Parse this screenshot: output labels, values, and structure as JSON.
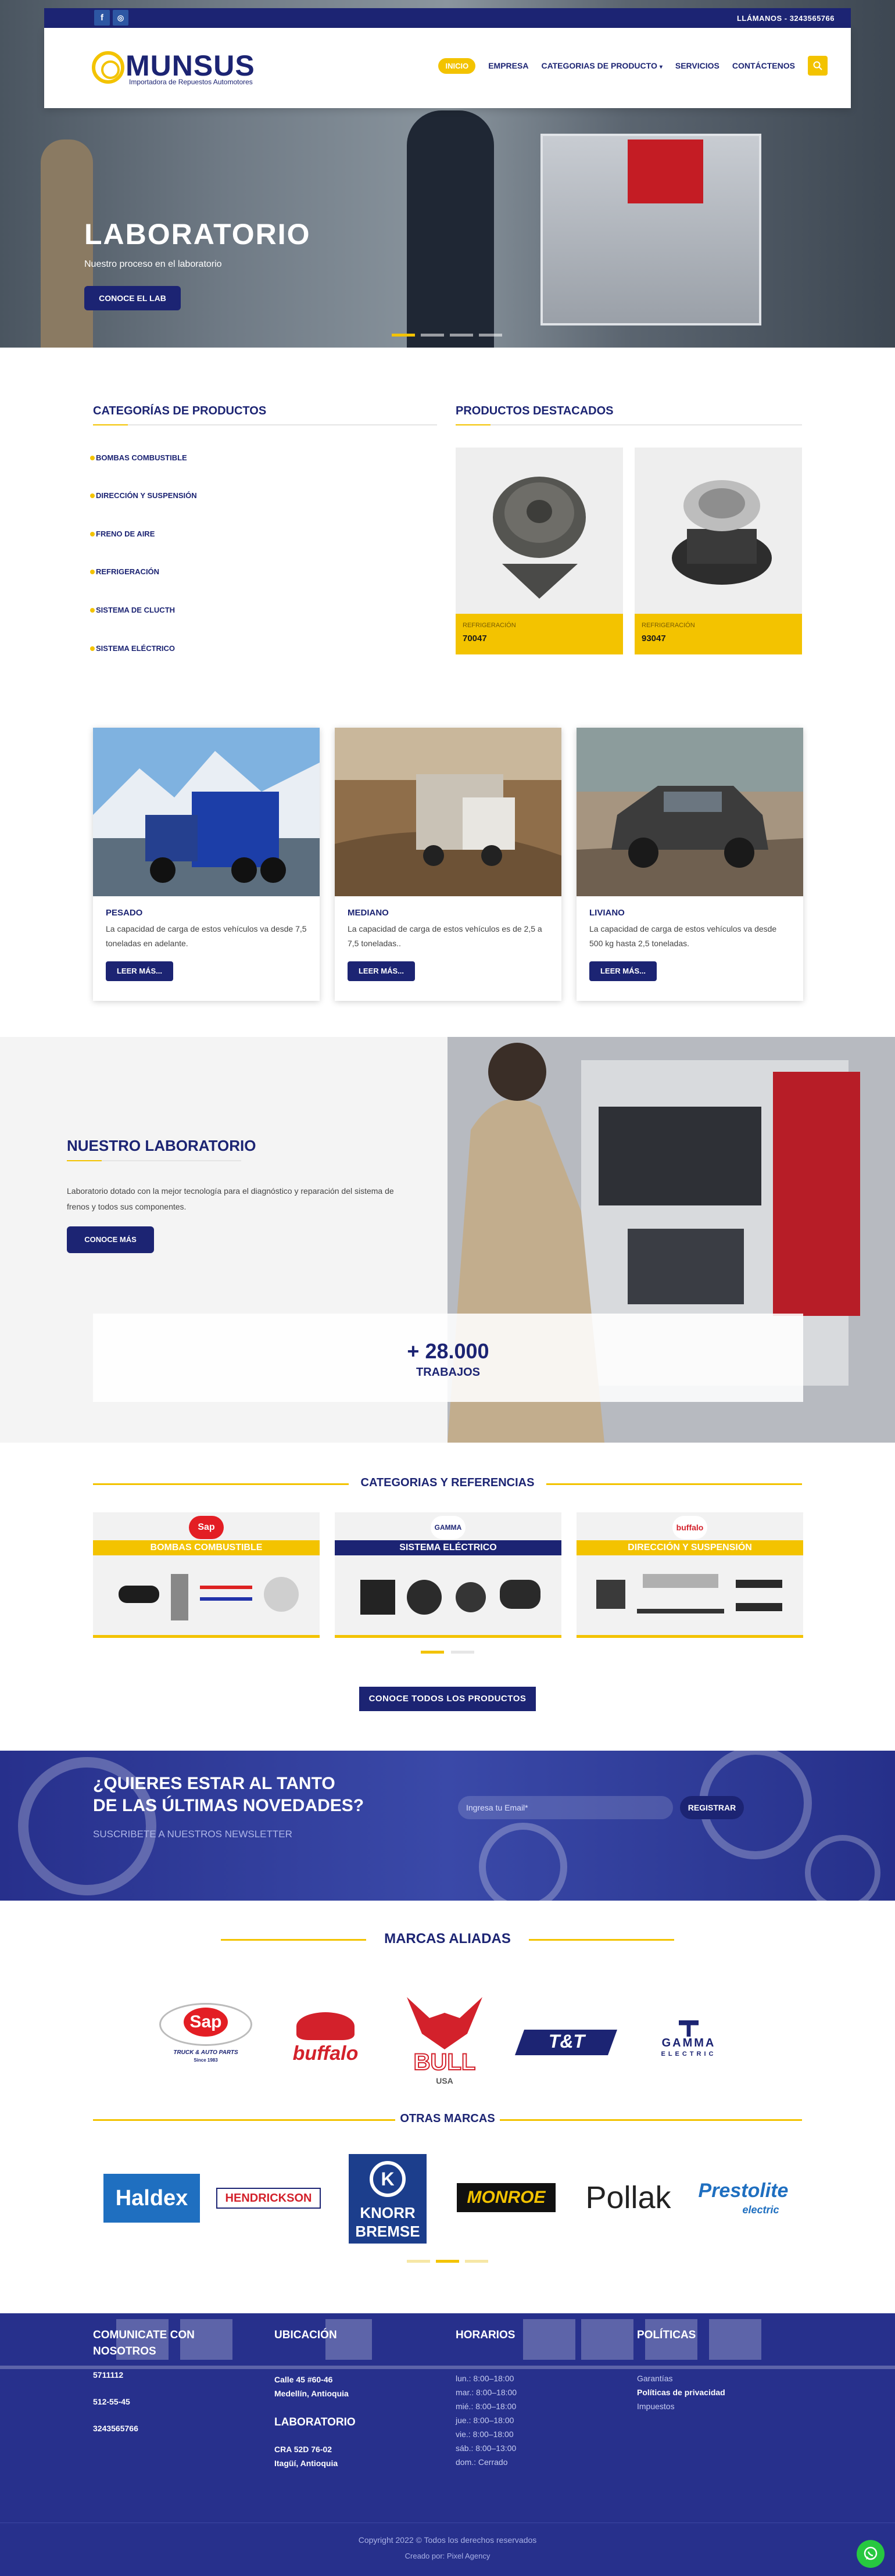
{
  "topbar": {
    "facebook_icon": "f",
    "instagram_icon": "◎",
    "phone": "LLÁMANOS - 3243565766"
  },
  "header": {
    "logo_text": "MUNSUS",
    "logo_sub": "Importadora de Repuestos Automotores",
    "nav": [
      "INICIO",
      "EMPRESA",
      "CATEGORIAS DE PRODUCTO",
      "SERVICIOS",
      "CONTÁCTENOS"
    ]
  },
  "hero": {
    "title": "LABORATORIO",
    "subtitle": "Nuestro proceso en el laboratorio",
    "button": "CONOCE EL LAB"
  },
  "categories": {
    "title": "CATEGORÍAS DE PRODUCTOS",
    "items": [
      "BOMBAS COMBUSTIBLE",
      "DIRECCIÓN Y SUSPENSIÓN",
      "FRENO DE AIRE",
      "REFRIGERACIÓN",
      "SISTEMA DE CLUCTH",
      "SISTEMA ELÉCTRICO"
    ]
  },
  "featured": {
    "title": "PRODUCTOS DESTACADOS",
    "products": [
      {
        "category": "REFRIGERACIÓN",
        "code": "70047"
      },
      {
        "category": "REFRIGERACIÓN",
        "code": "93047"
      }
    ]
  },
  "vehicles": [
    {
      "title": "PESADO",
      "desc": "La capacidad de carga de estos vehículos va desde 7,5 toneladas en adelante.",
      "button": "LEER MÁS..."
    },
    {
      "title": "MEDIANO",
      "desc": "La capacidad de carga de estos vehículos es de 2,5 a 7,5 toneladas..",
      "button": "LEER MÁS..."
    },
    {
      "title": "LIVIANO",
      "desc": "La capacidad de carga de estos vehículos va desde 500 kg hasta 2,5 toneladas.",
      "button": "LEER MÁS..."
    }
  ],
  "lab": {
    "title": "NUESTRO LABORATORIO",
    "desc": "Laboratorio dotado con la mejor tecnología para el diagnóstico y reparación del sistema de frenos y todos sus componentes.",
    "button": "CONOCE MÁS",
    "counter": "+ 28.000",
    "counter_label": "TRABAJOS"
  },
  "references": {
    "title": "CATEGORIAS Y REFERENCIAS",
    "cards": [
      {
        "band": "BOMBAS COMBUSTIBLE",
        "brand": "Sap",
        "color": "#f3c300"
      },
      {
        "band": "SISTEMA ELÉCTRICO",
        "brand": "GAMMA",
        "color": "#1c2473"
      },
      {
        "band": "DIRECCIÓN Y SUSPENSIÓN",
        "brand": "buffalo",
        "color": "#f3c300"
      }
    ],
    "button": "CONOCE TODOS LOS PRODUCTOS"
  },
  "newsletter": {
    "title1": "¿QUIERES ESTAR AL TANTO",
    "title2": "DE LAS ÚLTIMAS NOVEDADES?",
    "subtitle": "SUSCRIBETE A NUESTROS NEWSLETTER",
    "placeholder": "Ingresa tu Email*",
    "button": "REGISTRAR"
  },
  "brands": {
    "title": "MARCAS ALIADAS",
    "items": [
      "Sap",
      "TRUCK & AUTO PARTS",
      "Since 1983",
      "buffalo",
      "BULL",
      "USA",
      "T&T",
      "GAMMA",
      "ELECTRIC"
    ],
    "others_title": "OTRAS MARCAS",
    "others": [
      "Haldex",
      "HENDRICKSON",
      "KNORR",
      "BREMSE",
      "MONROE",
      "Pollak",
      "Prestolite",
      "electric"
    ]
  },
  "footer": {
    "contact_title": "COMUNICATE CON NOSOTROS",
    "contact": [
      "5711112",
      "512-55-45",
      "3243565766"
    ],
    "location_title": "UBICACIÓN",
    "location1": [
      "Calle 45 #60-46",
      "Medellín, Antioquia"
    ],
    "lab_title": "LABORATORIO",
    "location2": [
      "CRA 52D 76-02",
      "Itagüí, Antioquia"
    ],
    "hours_title": "HORARIOS",
    "hours": [
      "lun.: 8:00–18:00",
      "mar.: 8:00–18:00",
      "mié.: 8:00–18:00",
      "jue.: 8:00–18:00",
      "vie.: 8:00–18:00",
      "sáb.: 8:00–13:00",
      "dom.: Cerrado"
    ],
    "policies_title": "POLÍTICAS",
    "policies": [
      "Garantías",
      "Políticas de privacidad",
      "Impuestos"
    ],
    "copyright": "Copyright 2022 © Todos los derechos reservados",
    "made_by": "Creado por: Pixel Agency"
  },
  "colors": {
    "navy": "#1c2473",
    "yellow": "#f3c300",
    "whatsapp": "#27c840"
  }
}
